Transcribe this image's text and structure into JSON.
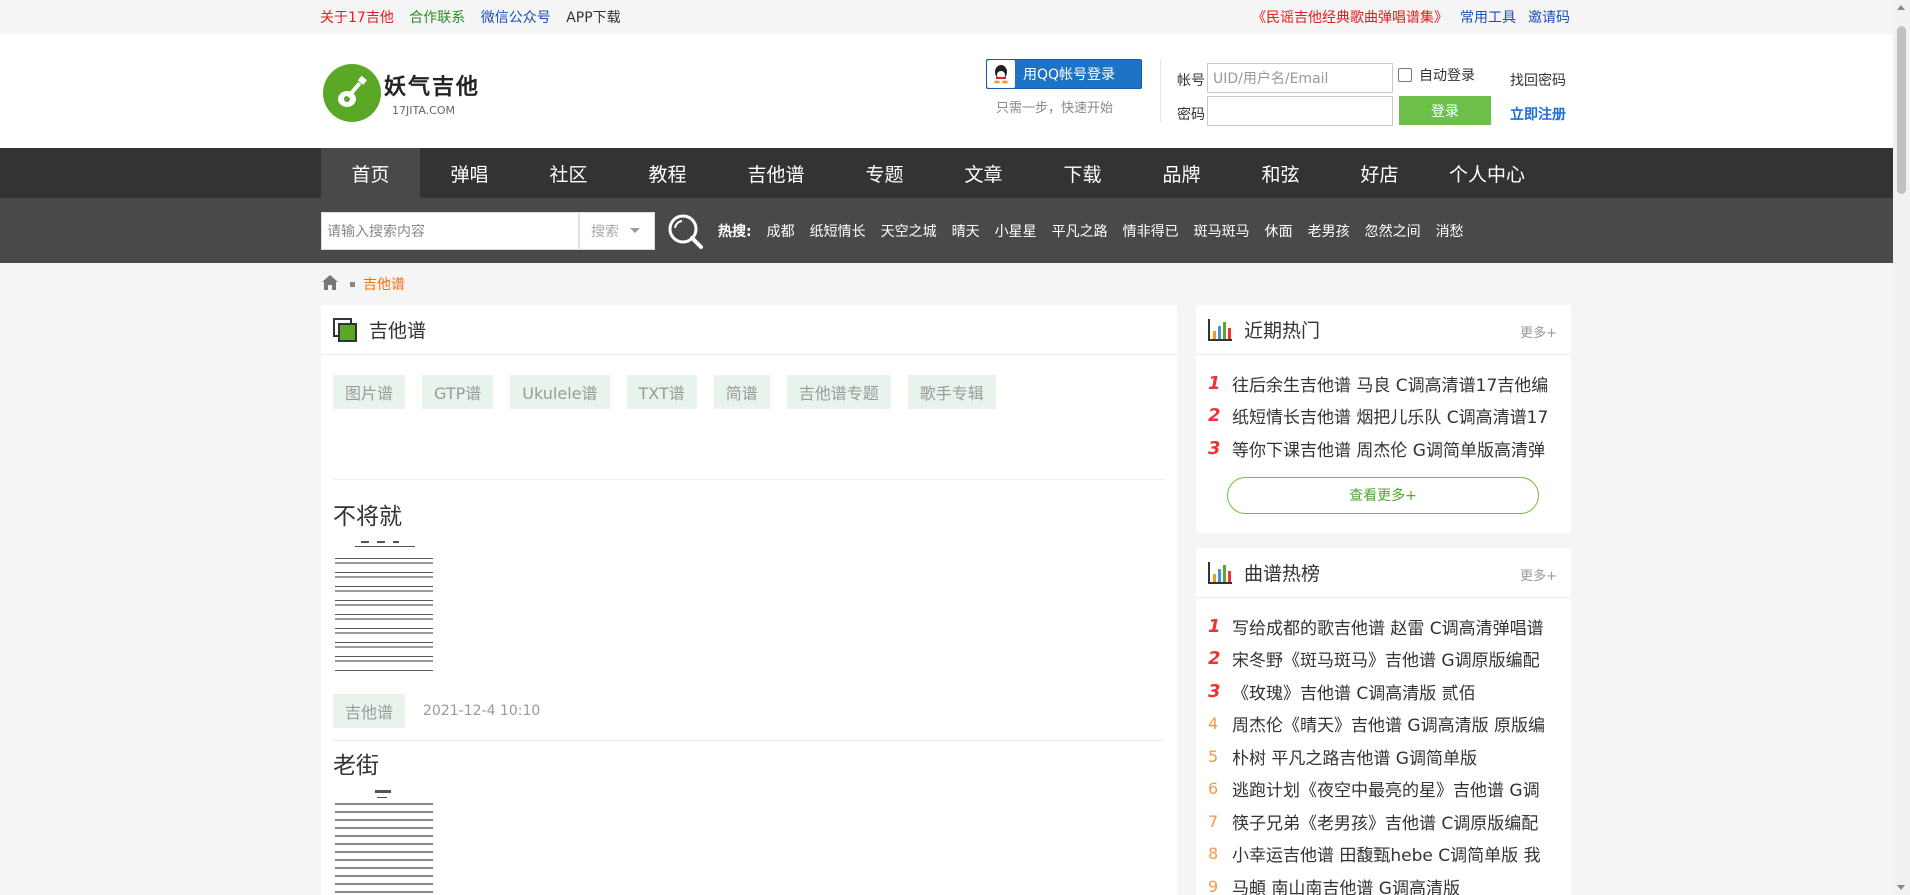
{
  "topbar": {
    "left_links": [
      {
        "label": "关于17吉他",
        "color": "#e02020"
      },
      {
        "label": "合作联系",
        "color": "#2a8f2a"
      },
      {
        "label": "微信公众号",
        "color": "#1a4fb5"
      },
      {
        "label": "APP下载",
        "color": "#333333"
      }
    ],
    "songbook_link": "《民谣吉他经典歌曲弹唱谱集》",
    "tools_link": "常用工具",
    "invite_link": "邀请码"
  },
  "logo": {
    "name": "妖气吉他",
    "domain": "17JITA.COM",
    "icon": "guitar-icon"
  },
  "login": {
    "qq_button": "用QQ帐号登录",
    "qq_subtitle": "只需一步，快速开始",
    "account_label": "帐号",
    "account_placeholder": "UID/用户名/Email",
    "password_label": "密码",
    "remember_label": "自动登录",
    "forgot_link": "找回密码",
    "login_button": "登录",
    "register_link": "立即注册"
  },
  "nav": {
    "items": [
      "首页",
      "弹唱",
      "社区",
      "教程",
      "吉他谱",
      "专题",
      "文章",
      "下载",
      "品牌",
      "和弦",
      "好店",
      "个人中心"
    ],
    "active_index": 0
  },
  "search": {
    "placeholder": "请输入搜索内容",
    "type_select": "搜索",
    "hot_label": "热搜:",
    "hot_words": [
      "成都",
      "纸短情长",
      "天空之城",
      "晴天",
      "小星星",
      "平凡之路",
      "情非得已",
      "斑马斑马",
      "休面",
      "老男孩",
      "忽然之间",
      "消愁"
    ]
  },
  "breadcrumb": {
    "current": "吉他谱"
  },
  "main": {
    "title": "吉他谱",
    "categories": [
      "图片谱",
      "GTP谱",
      "Ukulele谱",
      "TXT谱",
      "简谱",
      "吉他谱专题",
      "歌手专辑"
    ],
    "entries": [
      {
        "title": "不将就",
        "tag": "吉他谱",
        "date": "2021-12-4 10:10"
      },
      {
        "title": "老街"
      }
    ]
  },
  "side": {
    "recent_hot": {
      "title": "近期热门",
      "more": "更多+",
      "items": [
        "往后余生吉他谱 马良 C调高清谱17吉他编",
        "纸短情长吉他谱 烟把儿乐队 C调高清谱17",
        "等你下课吉他谱 周杰伦 G调简单版高清弹"
      ],
      "view_more": "查看更多+"
    },
    "chart": {
      "title": "曲谱热榜",
      "more": "更多+",
      "items": [
        "写给成都的歌吉他谱 赵雷 C调高清弹唱谱",
        "宋冬野《斑马斑马》吉他谱 G调原版编配",
        "《玫瑰》吉他谱 C调高清版 贰佰",
        "周杰伦《晴天》吉他谱 G调高清版 原版编",
        "朴树 平凡之路吉他谱 G调简单版",
        "逃跑计划《夜空中最亮的星》吉他谱 G调",
        "筷子兄弟《老男孩》吉他谱 C调原版编配",
        "小幸运吉他谱 田馥甄hebe C调简单版 我",
        "马頔 南山南吉他谱 G调高清版"
      ]
    }
  },
  "colors": {
    "accent_green": "#6cc04a",
    "nav_dark": "#333333",
    "breadcrumb_active": "#f07010",
    "rank_top": "#e33333",
    "rank_rest": "#f29a4a"
  }
}
